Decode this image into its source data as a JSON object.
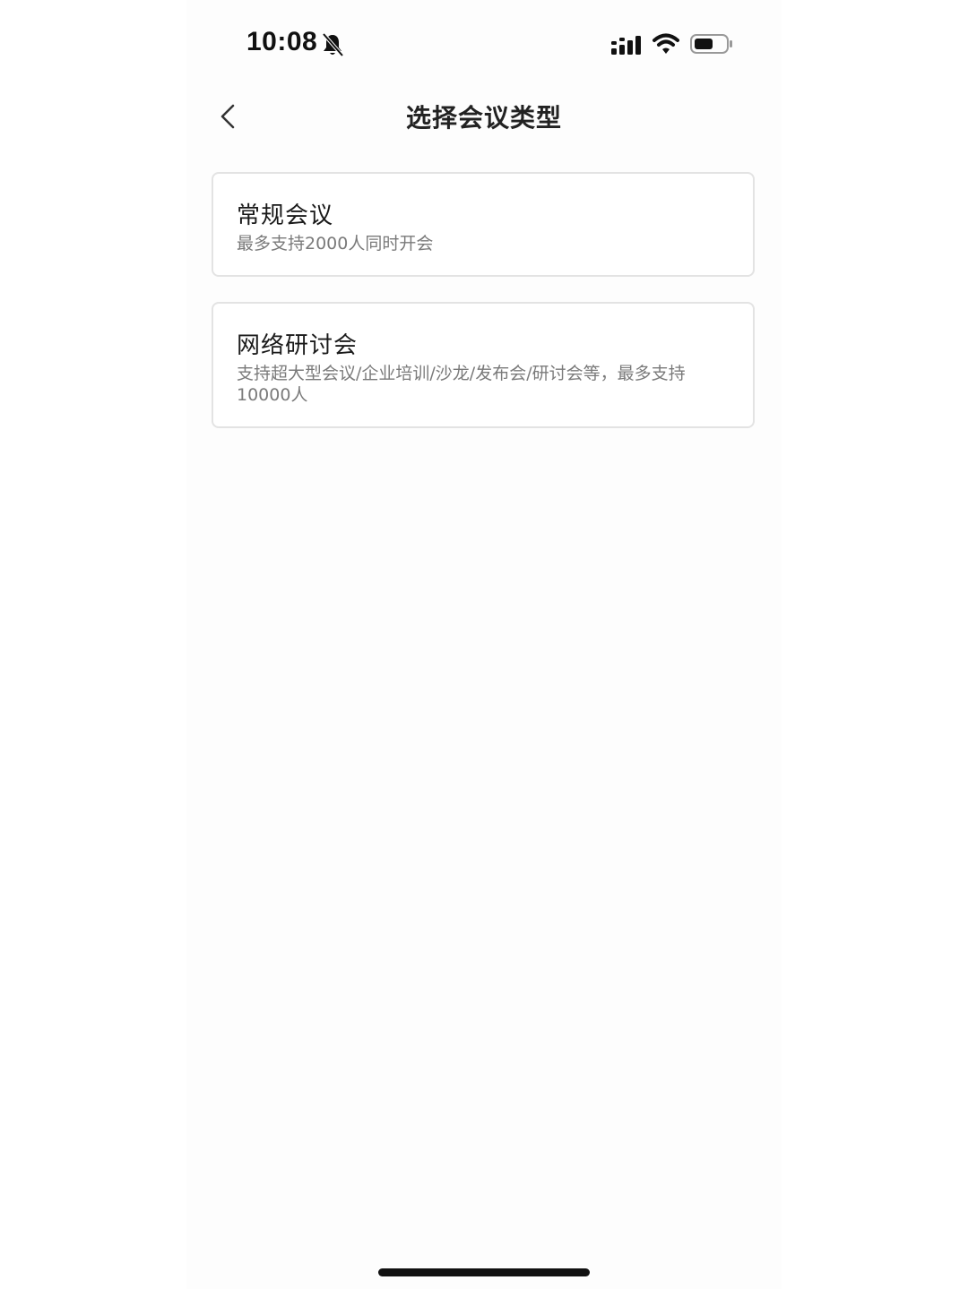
{
  "status_bar": {
    "time": "10:08",
    "icons": [
      "bell-slash-icon",
      "cellular-signal-icon",
      "wifi-icon",
      "battery-icon"
    ]
  },
  "nav": {
    "back_icon": "chevron-left-icon",
    "title": "选择会议类型"
  },
  "meeting_types": [
    {
      "title": "常规会议",
      "description": "最多支持2000人同时开会"
    },
    {
      "title": "网络研讨会",
      "description": "支持超大型会议/企业培训/沙龙/发布会/研讨会等，最多支持10000人"
    }
  ],
  "colors": {
    "background": "#fdfdfd",
    "card_border": "#e3e3e3",
    "title_text": "#1a1a1a",
    "desc_text": "#7a7a7a"
  }
}
